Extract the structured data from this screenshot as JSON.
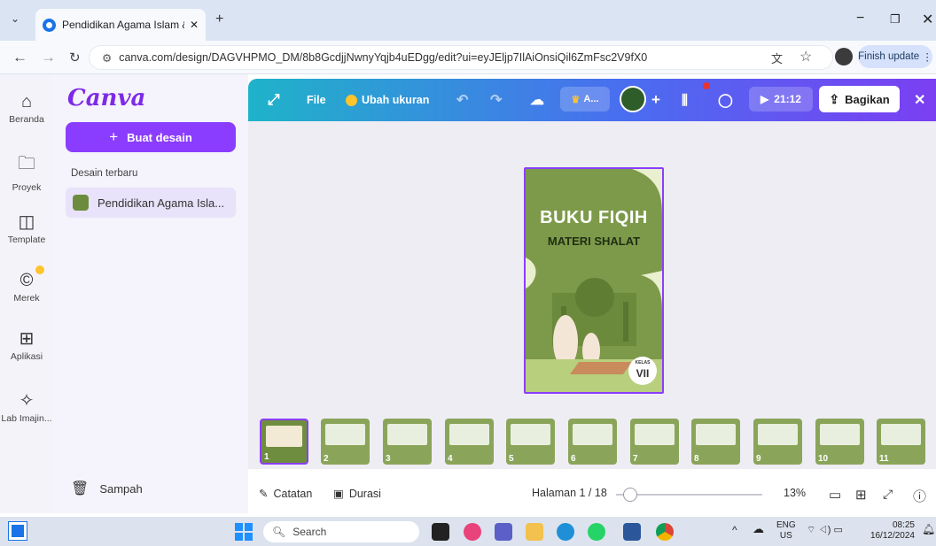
{
  "browser": {
    "tab_title": "Pendidikan Agama Islam & bud",
    "url": "canva.com/design/DAGVHPMO_DM/8b8GcdjjNwnyYqjb4uEDgg/edit?ui=eyJEljp7IlAiOnsiQil6ZmFsc2V9fX0",
    "finish_update": "Finish update"
  },
  "rail": {
    "items": [
      {
        "label": "Beranda",
        "icon": "home-icon"
      },
      {
        "label": "Proyek",
        "icon": "folder-icon"
      },
      {
        "label": "Template",
        "icon": "template-icon"
      },
      {
        "label": "Merek",
        "icon": "brand-icon"
      },
      {
        "label": "Aplikasi",
        "icon": "apps-icon"
      },
      {
        "label": "Lab Imajin...",
        "icon": "magic-lab-icon"
      }
    ]
  },
  "panel": {
    "logo": "Canva",
    "create_button": "Buat desain",
    "recent_label": "Desain terbaru",
    "recent_item": "Pendidikan Agama Isla...",
    "trash": "Sampah"
  },
  "topbar": {
    "file": "File",
    "resize": "Ubah ukuran",
    "account": "A...",
    "present_time": "21:12",
    "share": "Bagikan"
  },
  "page": {
    "title": "BUKU FIQIH",
    "subtitle": "MATERI SHALAT",
    "class_label": "KELAS",
    "class_value": "VII"
  },
  "thumbnails": [
    "1",
    "2",
    "3",
    "4",
    "5",
    "6",
    "7",
    "8",
    "9",
    "10",
    "11"
  ],
  "bottombar": {
    "notes": "Catatan",
    "duration": "Durasi",
    "page_indicator": "Halaman 1 / 18",
    "zoom": "13%",
    "page_fraction": 0.056
  },
  "taskbar": {
    "search_placeholder": "Search",
    "lang_top": "ENG",
    "lang_bottom": "US",
    "time": "08:25",
    "date": "16/12/2024"
  },
  "colors": {
    "canva_purple": "#8b3dff",
    "page_green": "#7d9a4a"
  }
}
